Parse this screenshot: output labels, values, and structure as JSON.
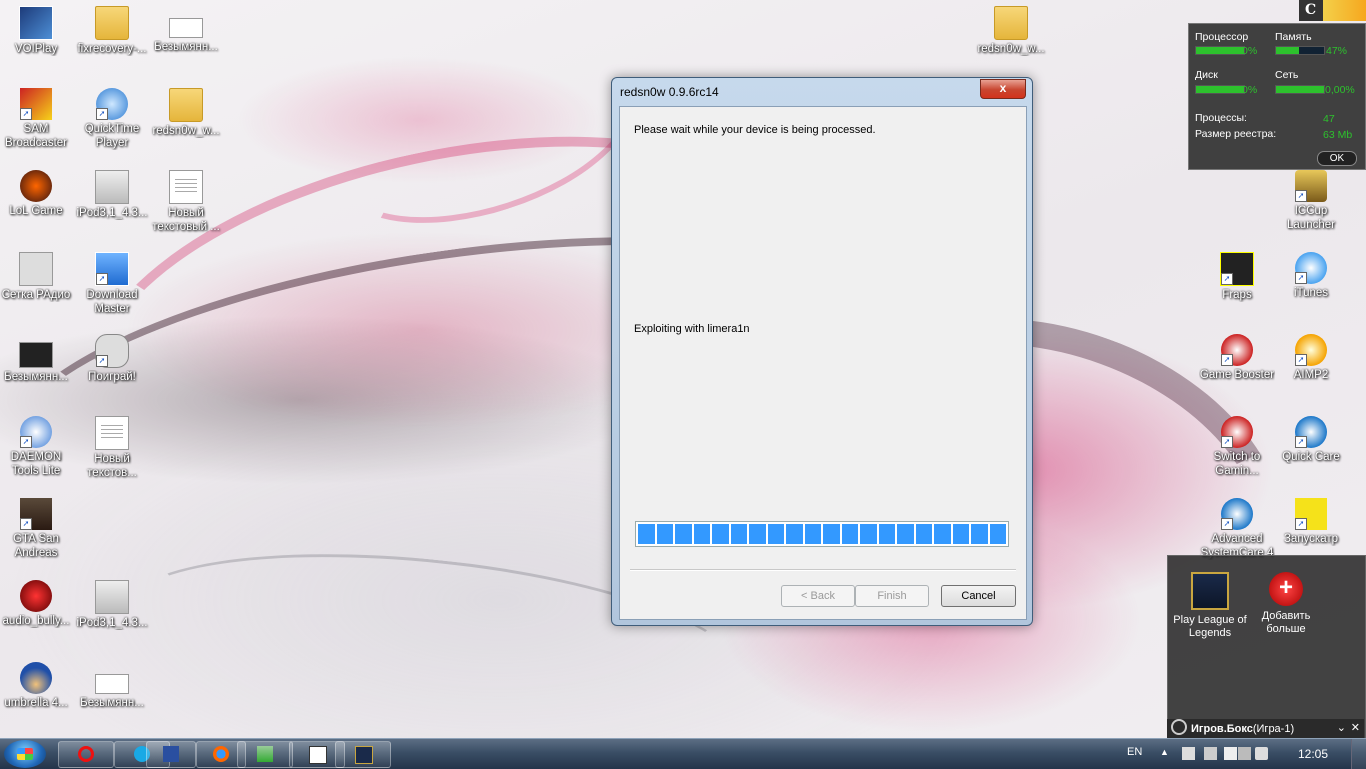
{
  "desktop": {
    "icons": [
      {
        "label": "VOIPlay"
      },
      {
        "label": "fixrecovery-..."
      },
      {
        "label": "Безымянн..."
      },
      {
        "label": "SAM Broadcaster"
      },
      {
        "label": "QuickTime Player"
      },
      {
        "label": "redsn0w_w..."
      },
      {
        "label": "LoL Game"
      },
      {
        "label": "iPod3,1_4.3..."
      },
      {
        "label": "Новый текстовый ..."
      },
      {
        "label": "Сетка РАдио"
      },
      {
        "label": "Download Master"
      },
      {
        "label": "Безымянн..."
      },
      {
        "label": "Поиграй!"
      },
      {
        "label": "DAEMON Tools Lite"
      },
      {
        "label": "Новый текстов..."
      },
      {
        "label": "GTA San Andreas"
      },
      {
        "label": "audio_bully..."
      },
      {
        "label": "iPod3,1_4.3..."
      },
      {
        "label": "umbrella 4..."
      },
      {
        "label": "Безымянн..."
      },
      {
        "label": "redsn0w_w..."
      },
      {
        "label": "ICCup Launcher"
      },
      {
        "label": "Fraps"
      },
      {
        "label": "iTunes"
      },
      {
        "label": "Game Booster"
      },
      {
        "label": "AIMP2"
      },
      {
        "label": "Switch to Gamin..."
      },
      {
        "label": "Quick Care"
      },
      {
        "label": "Advanced SystemCare 4"
      },
      {
        "label": "Запускатр"
      }
    ]
  },
  "sysmon": {
    "cpu_label": "Процессор",
    "cpu_value": "0%",
    "mem_label": "Память",
    "mem_value": "47%",
    "disk_label": "Диск",
    "disk_value": "0%",
    "net_label": "Сеть",
    "net_value": "0,00%",
    "proc_label": "Процессы:",
    "proc_value": "47",
    "reg_label": "Размер реестра:",
    "reg_value": "63 Mb",
    "ok_label": "OK",
    "badge": "C"
  },
  "dialog": {
    "title": "redsn0w 0.9.6rc14",
    "close_glyph": "x",
    "wait_message": "Please wait while your device is being processed.",
    "status_message": "Exploiting with limera1n",
    "progress_fraction": 1.0,
    "back_label": "< Back",
    "finish_label": "Finish",
    "cancel_label": "Cancel"
  },
  "gamebox": {
    "items": [
      {
        "label": "Play League of Legends"
      },
      {
        "label": "Добавить больше"
      }
    ],
    "bar_title": "Игров.Бокс",
    "bar_sub": "(Игра-1)",
    "collapse_glyph": "⌄",
    "close_glyph": "✕"
  },
  "taskbar": {
    "language": "EN",
    "time": "12:05"
  },
  "colors": {
    "progress": "#3399ff",
    "gadget_green": "#2dc12d"
  }
}
